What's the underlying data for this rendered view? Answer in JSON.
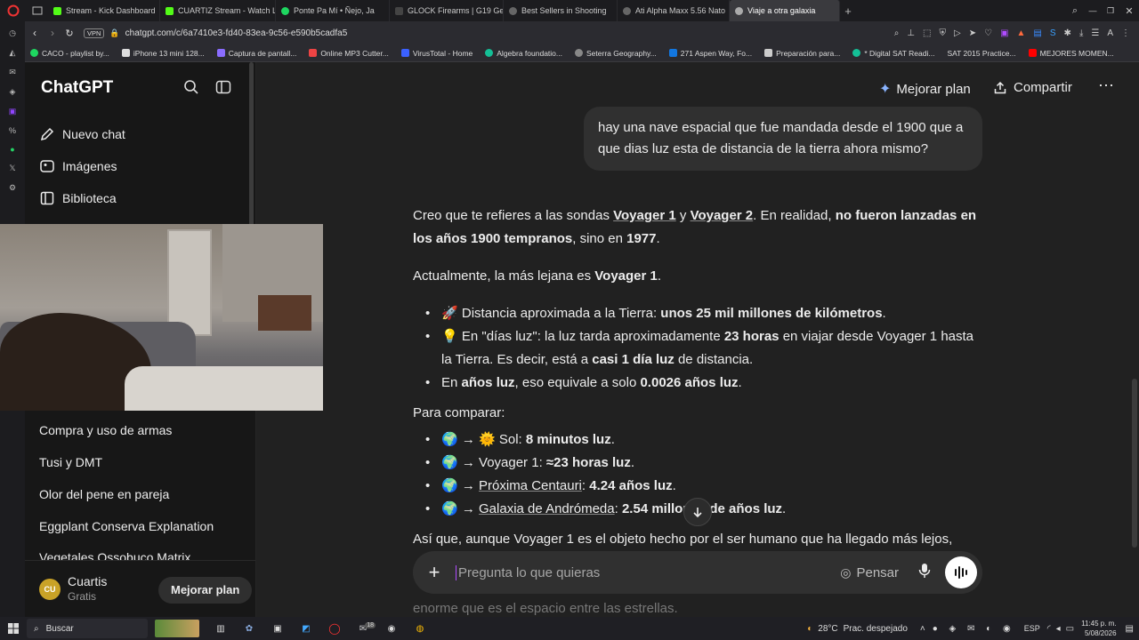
{
  "browser": {
    "tabs": [
      {
        "label": "Stream - Kick Dashboard",
        "color": "#53fc18"
      },
      {
        "label": "CUARTIZ Stream - Watch L",
        "color": "#53fc18"
      },
      {
        "label": "Ponte Pa Mí • Ñejo, Ja",
        "color": "#1ed760"
      },
      {
        "label": "GLOCK Firearms | G19 Ge",
        "color": "#444444"
      },
      {
        "label": "Best Sellers in Shooting",
        "color": "#666666"
      },
      {
        "label": "Ati Alpha Maxx 5.56 Nato",
        "color": "#666666"
      },
      {
        "label": "Viaje a otra galaxia",
        "color": "#aaaaaa"
      }
    ],
    "url": "chatgpt.com/c/6a7410e3-fd40-83ea-9c56-e590b5cadfa5",
    "vpn": "VPN",
    "bookmarks": [
      "CACO - playlist by...",
      "iPhone 13 mini 128...",
      "Captura de pantall...",
      "Online MP3 Cutter...",
      "VirusTotal - Home",
      "Algebra foundatio...",
      "Seterra Geography...",
      "271 Aspen Way, Fo...",
      "Preparación para...",
      "* Digital SAT Readi...",
      "SAT 2015 Practice...",
      "MEJORES MOMEN..."
    ]
  },
  "sidebar": {
    "logo": "ChatGPT",
    "nav": [
      {
        "label": "Nuevo chat",
        "icon": "edit-icon"
      },
      {
        "label": "Imágenes",
        "icon": "images-icon"
      },
      {
        "label": "Biblioteca",
        "icon": "library-icon"
      }
    ],
    "chats": [
      "Compra y uso de armas",
      "Tusi y DMT",
      "Olor del pene en pareja",
      "Eggplant Conserva Explanation",
      "Vegetales Ossobuco Matrix"
    ],
    "user": {
      "initials": "CU",
      "name": "Cuartis",
      "plan": "Gratis",
      "upgrade": "Mejorar plan"
    }
  },
  "header": {
    "upgrade": "Mejorar plan",
    "share": "Compartir"
  },
  "conversation": {
    "user_message": "hay una nave espacial que fue mandada desde el 1900 que a que dias luz esta de distancia de la tierra ahora mismo?",
    "p1": {
      "a": "Creo que te refieres a las sondas ",
      "v1": "Voyager 1",
      "y": " y ",
      "v2": "Voyager 2",
      "b": ". En realidad, ",
      "bold": "no fueron lanzadas en los años 1900 tempranos",
      "c": ", sino en ",
      "year": "1977",
      "d": "."
    },
    "p2": {
      "a": "Actualmente, la más lejana es ",
      "bold": "Voyager 1",
      "b": "."
    },
    "bullets": [
      {
        "emoji": "🚀",
        "a": " Distancia aproximada a la Tierra: ",
        "bold": "unos 25 mil millones de kilómetros",
        "b": "."
      },
      {
        "emoji": "💡",
        "a": " En \"días luz\": la luz tarda aproximadamente ",
        "bold": "23 horas",
        "b": " en viajar desde Voyager 1 hasta la Tierra. Es decir, está a ",
        "bold2": "casi 1 día luz",
        "c": " de distancia."
      },
      {
        "a": "En ",
        "bold": "años luz",
        "b": ", eso equivale a solo ",
        "bold2": "0.0026 años luz",
        "c": "."
      }
    ],
    "compare_title": "Para comparar:",
    "compare": [
      {
        "a": "🌍 → 🌞 Sol: ",
        "bold": "8 minutos luz",
        "b": "."
      },
      {
        "a": "🌍 → Voyager 1: ",
        "bold": "≈23 horas luz",
        "b": "."
      },
      {
        "a": "🌍 → ",
        "link": "Próxima Centauri",
        "c": ": ",
        "bold": "4.24 años luz",
        "b": "."
      },
      {
        "a": "🌍 → ",
        "link": "Galaxia de Andrómeda",
        "c": ": ",
        "bold": "2.54 millones de años luz",
        "b": "."
      }
    ],
    "closing": "Así que, aunque Voyager 1 es el objeto hecho por el ser humano que ha llegado más lejos,",
    "closing2": "enorme que es el espacio entre las estrellas."
  },
  "composer": {
    "placeholder": "Pregunta lo que quieras",
    "think": "Pensar"
  },
  "taskbar": {
    "search": "Buscar",
    "weather": "28°C",
    "weather_desc": "Prac. despejado",
    "lang": "ESP",
    "time": "11:45 p. m.",
    "date": "5/08/2026",
    "badge": "18"
  }
}
